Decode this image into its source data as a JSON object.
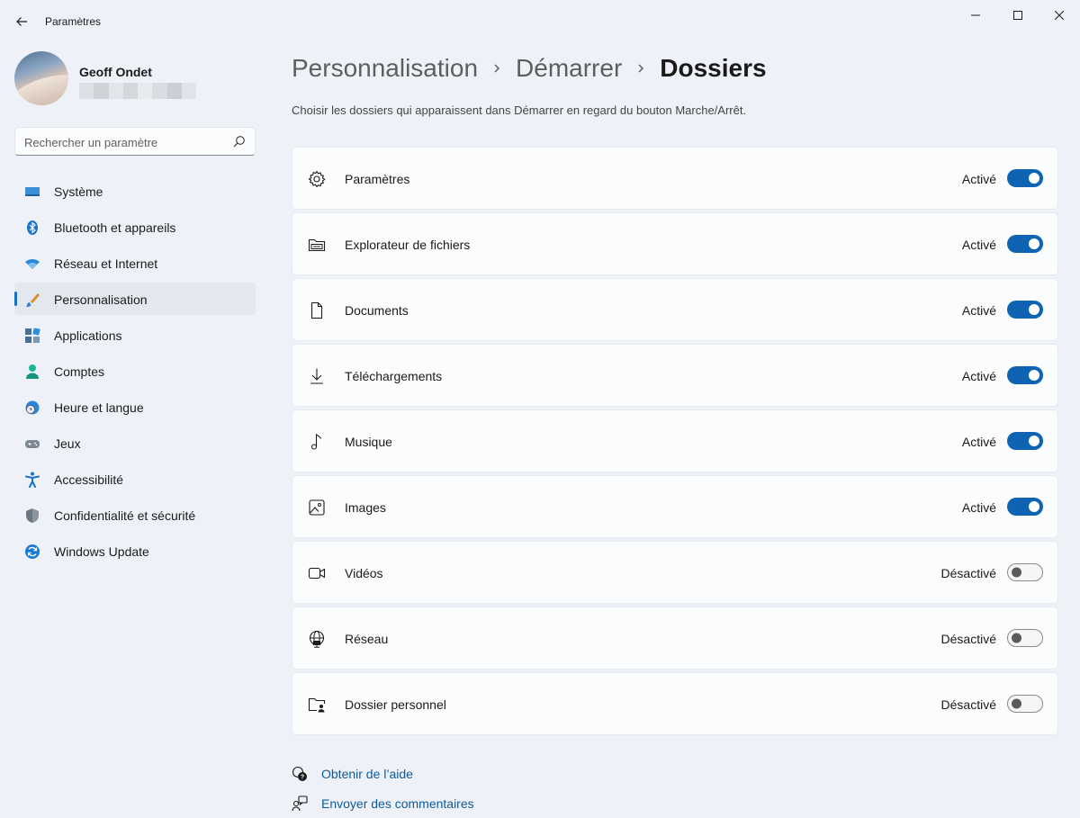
{
  "window": {
    "title": "Paramètres"
  },
  "profile": {
    "name": "Geoff Ondet"
  },
  "search": {
    "placeholder": "Rechercher un paramètre"
  },
  "sidebar": {
    "items": [
      {
        "label": "Système",
        "icon": "system-icon"
      },
      {
        "label": "Bluetooth et appareils",
        "icon": "bluetooth-icon"
      },
      {
        "label": "Réseau et Internet",
        "icon": "wifi-icon"
      },
      {
        "label": "Personnalisation",
        "icon": "brush-icon",
        "active": true
      },
      {
        "label": "Applications",
        "icon": "apps-icon"
      },
      {
        "label": "Comptes",
        "icon": "account-icon"
      },
      {
        "label": "Heure et langue",
        "icon": "clock-globe-icon"
      },
      {
        "label": "Jeux",
        "icon": "gamepad-icon"
      },
      {
        "label": "Accessibilité",
        "icon": "accessibility-icon"
      },
      {
        "label": "Confidentialité et sécurité",
        "icon": "shield-icon"
      },
      {
        "label": "Windows Update",
        "icon": "update-icon"
      }
    ]
  },
  "breadcrumb": {
    "items": [
      "Personnalisation",
      "Démarrer",
      "Dossiers"
    ]
  },
  "main": {
    "description": "Choisir les dossiers qui apparaissent dans Démarrer en regard du bouton Marche/Arrêt.",
    "folders": [
      {
        "label": "Paramètres",
        "state": "Activé",
        "on": true,
        "icon": "gear-icon"
      },
      {
        "label": "Explorateur de fichiers",
        "state": "Activé",
        "on": true,
        "icon": "file-explorer-icon"
      },
      {
        "label": "Documents",
        "state": "Activé",
        "on": true,
        "icon": "document-icon"
      },
      {
        "label": "Téléchargements",
        "state": "Activé",
        "on": true,
        "icon": "download-icon"
      },
      {
        "label": "Musique",
        "state": "Activé",
        "on": true,
        "icon": "music-icon"
      },
      {
        "label": "Images",
        "state": "Activé",
        "on": true,
        "icon": "image-icon"
      },
      {
        "label": "Vidéos",
        "state": "Désactivé",
        "on": false,
        "icon": "video-icon"
      },
      {
        "label": "Réseau",
        "state": "Désactivé",
        "on": false,
        "icon": "network-icon"
      },
      {
        "label": "Dossier personnel",
        "state": "Désactivé",
        "on": false,
        "icon": "personal-folder-icon"
      }
    ]
  },
  "footer": {
    "help": "Obtenir de l’aide",
    "feedback": "Envoyer des commentaires"
  },
  "colors": {
    "accent": "#0e63b3",
    "background": "#eef2f8",
    "card": "#fbfcfd",
    "link": "#0b5a9c"
  }
}
